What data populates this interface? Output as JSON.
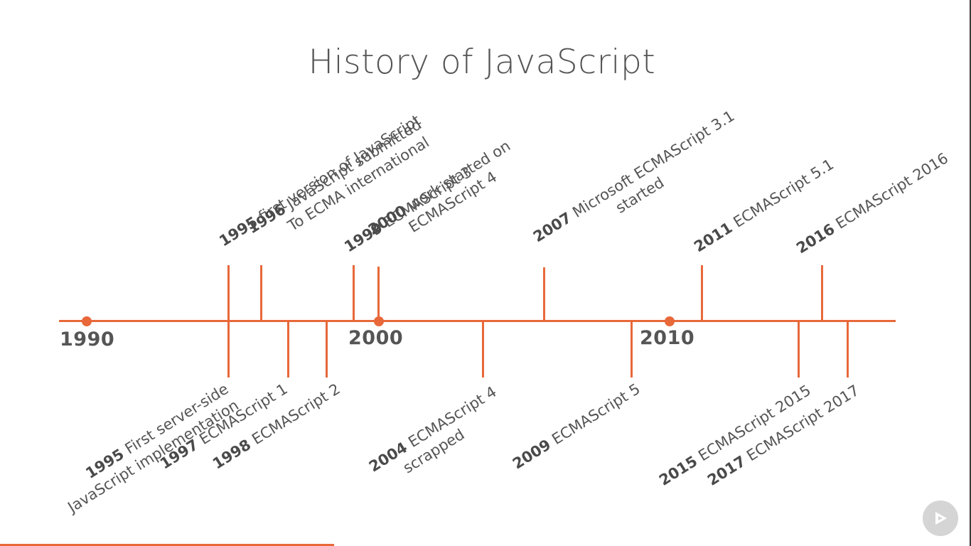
{
  "title": "History of JavaScript",
  "decades": [
    "1990",
    "2000",
    "2010"
  ],
  "events_above": [
    {
      "year": "1995",
      "lines": [
        "first version of JavaScript"
      ]
    },
    {
      "year": "1996",
      "lines": [
        "JavaScript submitted",
        "To ECMA international"
      ]
    },
    {
      "year": "1999",
      "lines": [
        "ECMAScript 3"
      ]
    },
    {
      "year": "2000",
      "lines": [
        "work started on",
        "ECMAScript 4"
      ]
    },
    {
      "year": "2007",
      "lines": [
        "Microsoft ECMAScript 3.1",
        "started"
      ]
    },
    {
      "year": "2011",
      "lines": [
        "ECMAScript 5.1"
      ]
    },
    {
      "year": "2016",
      "lines": [
        "ECMAScript 2016"
      ]
    }
  ],
  "events_below": [
    {
      "year": "1995",
      "lines": [
        "First server-side",
        "JavaScript implementation"
      ]
    },
    {
      "year": "1997",
      "lines": [
        "ECMAScript 1"
      ]
    },
    {
      "year": "1998",
      "lines": [
        "ECMAScript 2"
      ]
    },
    {
      "year": "2004",
      "lines": [
        "ECMAScript 4",
        "scrapped"
      ]
    },
    {
      "year": "2009",
      "lines": [
        "ECMAScript 5"
      ]
    },
    {
      "year": "2015",
      "lines": [
        "ECMAScript 2015"
      ]
    },
    {
      "year": "2017",
      "lines": [
        "ECMAScript 2017"
      ]
    }
  ],
  "colors": {
    "accent": "#e8683a",
    "text": "#555555"
  },
  "player": {
    "icon": "play-icon"
  }
}
